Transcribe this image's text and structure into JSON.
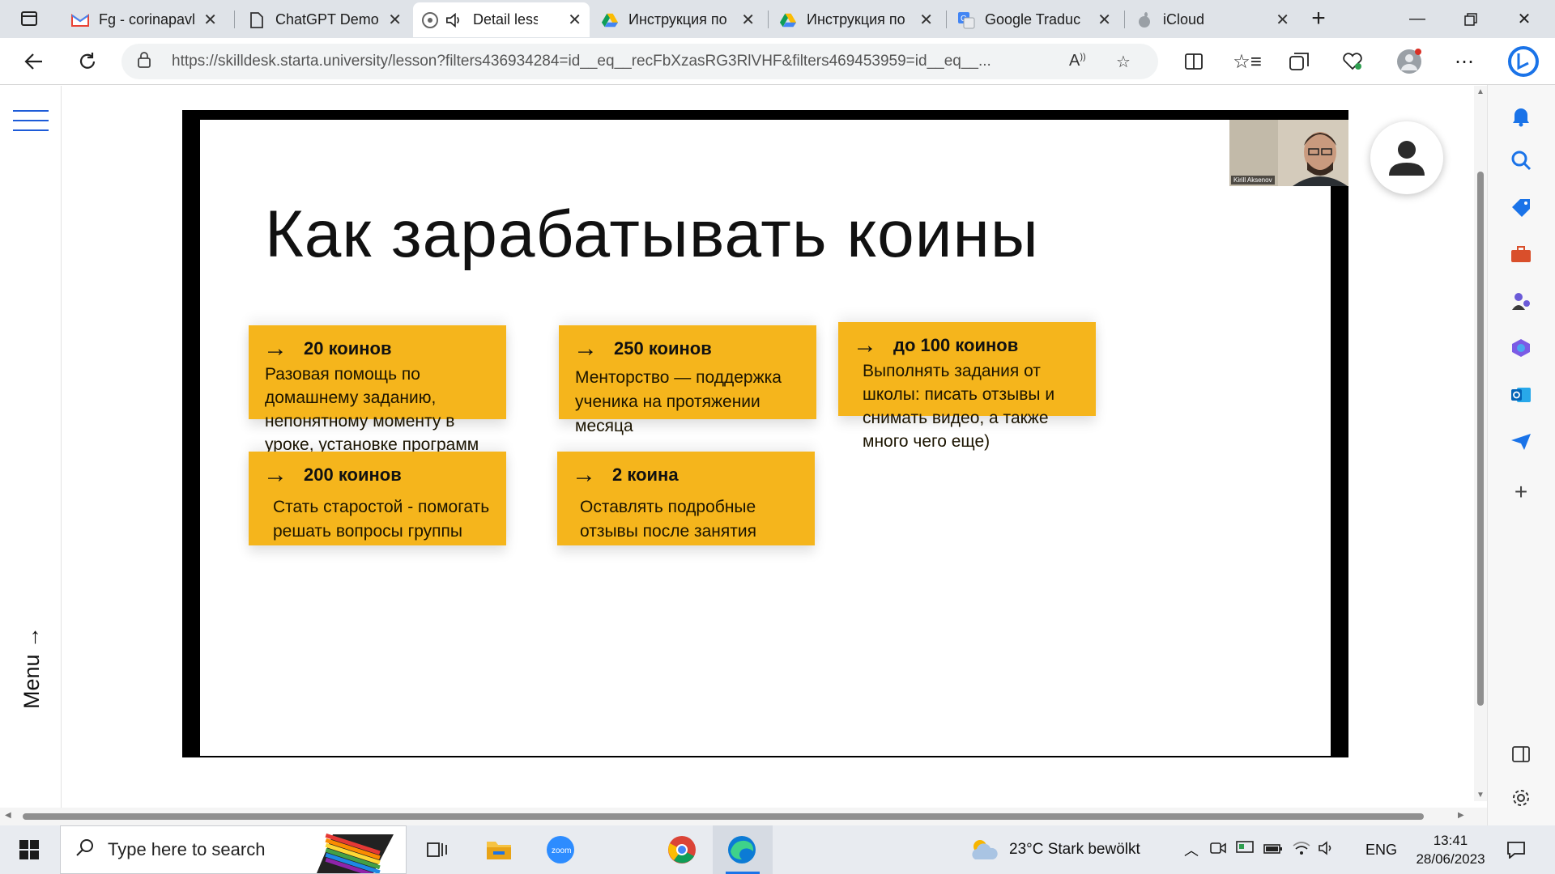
{
  "browser": {
    "tabs": [
      {
        "title": "Fg - corinapavl",
        "icon": "gmail-icon"
      },
      {
        "title": "ChatGPT Demo",
        "icon": "page-icon"
      },
      {
        "title": "Detail less",
        "icon": "tab-audio-icon"
      },
      {
        "title": "Инструкция по",
        "icon": "google-drive-icon"
      },
      {
        "title": "Инструкция по",
        "icon": "google-drive-icon"
      },
      {
        "title": "Google Traduc",
        "icon": "google-translate-icon"
      },
      {
        "title": "iCloud",
        "icon": "apple-icon"
      }
    ],
    "url": "https://skilldesk.starta.university/lesson?filters436934284=id__eq__recFbXzasRG3RlVHF&filters469453959=id__eq__..."
  },
  "page": {
    "menu_label": "Menu →",
    "slide": {
      "title": "Как зарабатывать коины",
      "cards": [
        {
          "head": "20 коинов",
          "body": "Разовая помощь по домашнему заданию, непонятному моменту в уроке, установке программ"
        },
        {
          "head": "250 коинов",
          "body": "Менторство — поддержка ученика на протяжении месяца"
        },
        {
          "head": "до 100 коинов",
          "body": "Выполнять задания от школы: писать отзывы и снимать видео, а также много чего еще)"
        },
        {
          "head": "200 коинов",
          "body": "Стать старостой - помогать решать вопросы группы"
        },
        {
          "head": "2 коина",
          "body": "Оставлять подробные отзывы после занятия"
        }
      ],
      "webcam_name": "Kirill Aksenov"
    }
  },
  "taskbar": {
    "search_placeholder": "Type here to search",
    "weather": "23°C  Stark bewölkt",
    "language": "ENG",
    "time": "13:41",
    "date": "28/06/2023"
  },
  "colors": {
    "card": "#f5b51c",
    "accent": "#1d5bd8"
  }
}
